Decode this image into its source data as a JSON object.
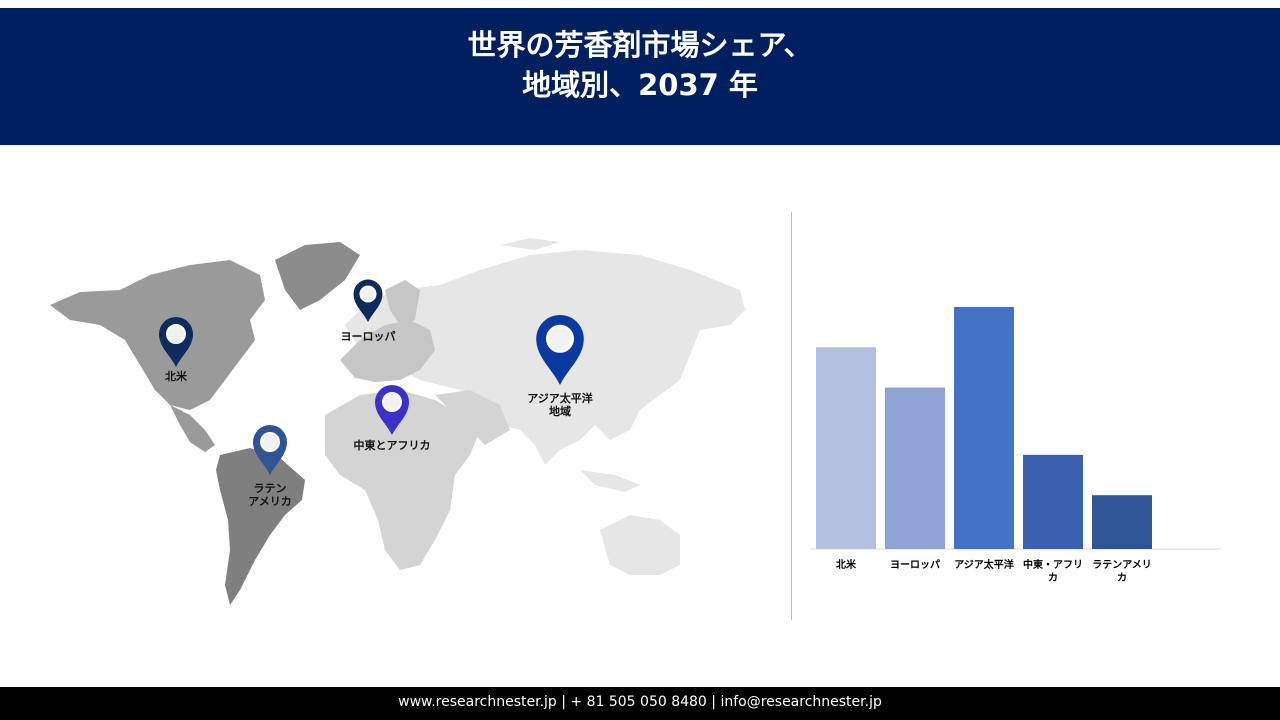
{
  "title": {
    "line1": "世界の芳香剤市場シェア、",
    "line2": "地域別、2037 年"
  },
  "map": {
    "pins": [
      {
        "label_lines": [
          "北米"
        ],
        "color": "#0f2a5c"
      },
      {
        "label_lines": [
          "ヨーロッパ"
        ],
        "color": "#0f2a5c"
      },
      {
        "label_lines": [
          "アジア太平洋",
          "地域"
        ],
        "color": "#0a3aa0"
      },
      {
        "label_lines": [
          "中東とアフリカ"
        ],
        "color": "#3a32c8"
      },
      {
        "label_lines": [
          "ラテン",
          "アメリカ"
        ],
        "color": "#2f5597"
      }
    ]
  },
  "chart_data": {
    "type": "bar",
    "categories": [
      "北米",
      "ヨーロッパ",
      "アジア太平洋",
      "中東・アフリカ",
      "ラテンアメリカ"
    ],
    "tick_label_lines": [
      [
        "北米"
      ],
      [
        "ヨーロッパ"
      ],
      [
        "アジア太平洋"
      ],
      [
        "中東・アフリ",
        "カ"
      ],
      [
        "ラテンアメリ",
        "カ"
      ]
    ],
    "values": [
      30,
      24,
      36,
      14,
      8
    ],
    "ylim": [
      0,
      40
    ],
    "colors": [
      "#b4c0e0",
      "#8ea3d4",
      "#4472c4",
      "#3a5fad",
      "#2f5597"
    ],
    "title": "",
    "xlabel": "",
    "ylabel": "",
    "grid": false
  },
  "footer": {
    "text": "www.researchnester.jp | + 81 505 050 8480 | info@researchnester.jp"
  }
}
